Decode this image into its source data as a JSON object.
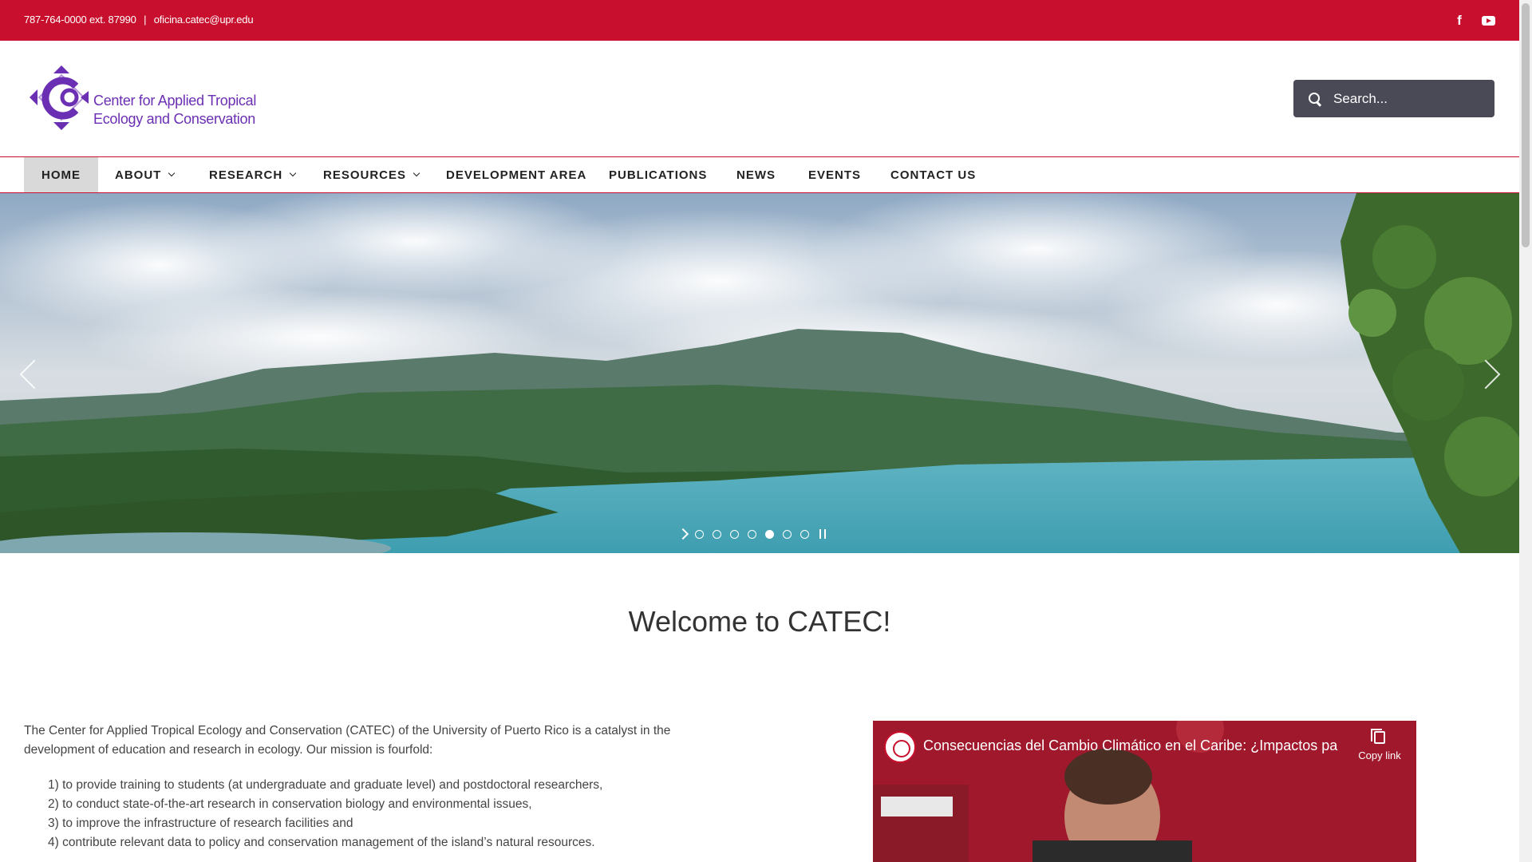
{
  "topbar": {
    "phone": "787-764-0000 ext. 87990",
    "separator": "|",
    "email": "oficina.catec@upr.edu",
    "social": [
      "facebook-icon",
      "youtube-icon"
    ]
  },
  "header": {
    "logo_line1": "Center for Applied Tropical",
    "logo_line2": "Ecology and Conservation",
    "search_placeholder": "Search..."
  },
  "nav": {
    "items": [
      {
        "label": "HOME",
        "active": true,
        "dropdown": false
      },
      {
        "label": "ABOUT",
        "dropdown": true
      },
      {
        "label": "RESEARCH",
        "dropdown": true
      },
      {
        "label": "RESOURCES",
        "dropdown": true
      },
      {
        "label": "DEVELOPMENT AREA",
        "dropdown": false
      },
      {
        "label": "PUBLICATIONS",
        "dropdown": false
      },
      {
        "label": "NEWS",
        "dropdown": false
      },
      {
        "label": "EVENTS",
        "dropdown": false
      },
      {
        "label": "CONTACT US",
        "dropdown": false
      }
    ]
  },
  "slider": {
    "slide_count": 7,
    "active_slide": 5
  },
  "main": {
    "welcome": "Welcome to CATEC!",
    "intro": "The Center for Applied Tropical Ecology and Conservation (CATEC) of the University of Puerto Rico is a catalyst in the development of education and research in ecology. Our mission is fourfold:",
    "mission": [
      "1) to provide training to students (at undergraduate and graduate level) and postdoctoral researchers,",
      "2) to conduct state-of-the-art research in conservation biology and environmental issues,",
      "3) to improve the infrastructure of research facilities and",
      "4) contribute relevant data to policy and conservation management of the island’s natural resources."
    ]
  },
  "video": {
    "title": "Consecuencias del Cambio Climático en el Caribe: ¿Impactos pa...",
    "copy_link": "Copy link"
  },
  "colors": {
    "brand_red": "#c8102e",
    "logo_purple": "#6b2fb3",
    "search_bg": "#4a4a57"
  }
}
